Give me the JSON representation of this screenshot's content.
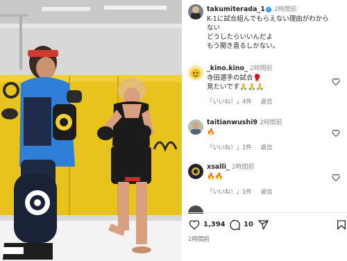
{
  "post": {
    "username": "takumiterada_1",
    "time": "2時間前",
    "caption_lines": [
      "K-1に試合組んでもらえない理由がわから",
      "ない",
      "どうしたらいいんだよ",
      "もう開き直るしかない。"
    ]
  },
  "comments": [
    {
      "username": "_kino.kino_",
      "time": "2時間前",
      "lines": [
        "寺田選手の試合🥊",
        "見たいです🙏🙏🙏"
      ],
      "likes_label": "「いいね！」4件",
      "reply_label": "返信",
      "avatar": "yellow-character-avatar"
    },
    {
      "username": "taitianwushi9",
      "time": "2時間前",
      "lines": [
        "🔥"
      ],
      "likes_label": "「いいね！」1件",
      "reply_label": "返信",
      "avatar": "person-photo-avatar"
    },
    {
      "username": "xsalli_",
      "time": "2時間前",
      "lines": [
        "🔥🔥"
      ],
      "likes_label": "「いいね！」1件",
      "reply_label": "返信",
      "avatar": "dark-logo-avatar"
    }
  ],
  "actions": {
    "likes_count": "1,394",
    "comments_count": "10",
    "icons": [
      "heart-icon",
      "comment-icon",
      "share-icon",
      "bookmark-icon"
    ]
  },
  "footer": {
    "post_time": "2時間前"
  },
  "colors": {
    "verified": "#3897f0",
    "meta_gray": "#737373",
    "wall_yellow": "#e8c21d"
  }
}
